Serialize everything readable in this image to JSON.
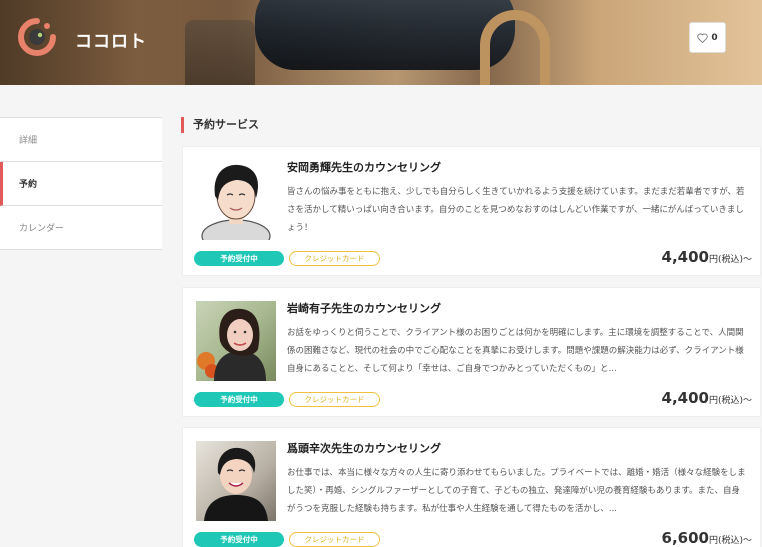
{
  "header": {
    "shop_name": "ココロト",
    "favorite_count": "0",
    "logo_icon": "logo-icon",
    "favorite_icon": "heart-icon"
  },
  "sidebar": {
    "items": [
      {
        "label": "詳細",
        "active": false
      },
      {
        "label": "予約",
        "active": true
      },
      {
        "label": "カレンダー",
        "active": false
      }
    ]
  },
  "main": {
    "section_title": "予約サービス",
    "services": [
      {
        "title": "安岡勇輝先生のカウンセリング",
        "description": "皆さんの悩み事をともに抱え、少しでも自分らしく生きていかれるよう支援を続けています。まだまだ若輩者ですが、若さを活かして精いっぱい向き合います。自分のことを見つめなおすのはしんどい作業ですが、一緒にがんばっていきましょう！",
        "badge": "予約受付中",
        "payment": "クレジットカード",
        "price": "4,400",
        "price_suffix": "円(税込)〜"
      },
      {
        "title": "岩崎有子先生のカウンセリング",
        "description": "お話をゆっくりと伺うことで、クライアント様のお困りごとは何かを明確にします。主に環境を調整することで、人間関係の困難さなど、現代の社会の中でご心配なことを真摯にお受けします。問題や課題の解決能力は必ず、クライアント様自身にあることと、そして何より「幸せは、ご自身でつかみとっていただくもの」と...",
        "badge": "予約受付中",
        "payment": "クレジットカード",
        "price": "4,400",
        "price_suffix": "円(税込)〜"
      },
      {
        "title": "爲頭辛次先生のカウンセリング",
        "description": "お仕事では、本当に様々な方々の人生に寄り添わせてもらいました。プライベートでは、離婚・婚活（様々な経験をしました笑）・再婚、シングルファーザーとしての子育て、子どもの独立、発達障がい児の養育経験もあります。また、自身がうつを克服した経験も持ちます。私が仕事や人生経験を通して得たものを活かし、...",
        "badge": "予約受付中",
        "payment": "クレジットカード",
        "price": "6,600",
        "price_suffix": "円(税込)〜"
      }
    ]
  }
}
